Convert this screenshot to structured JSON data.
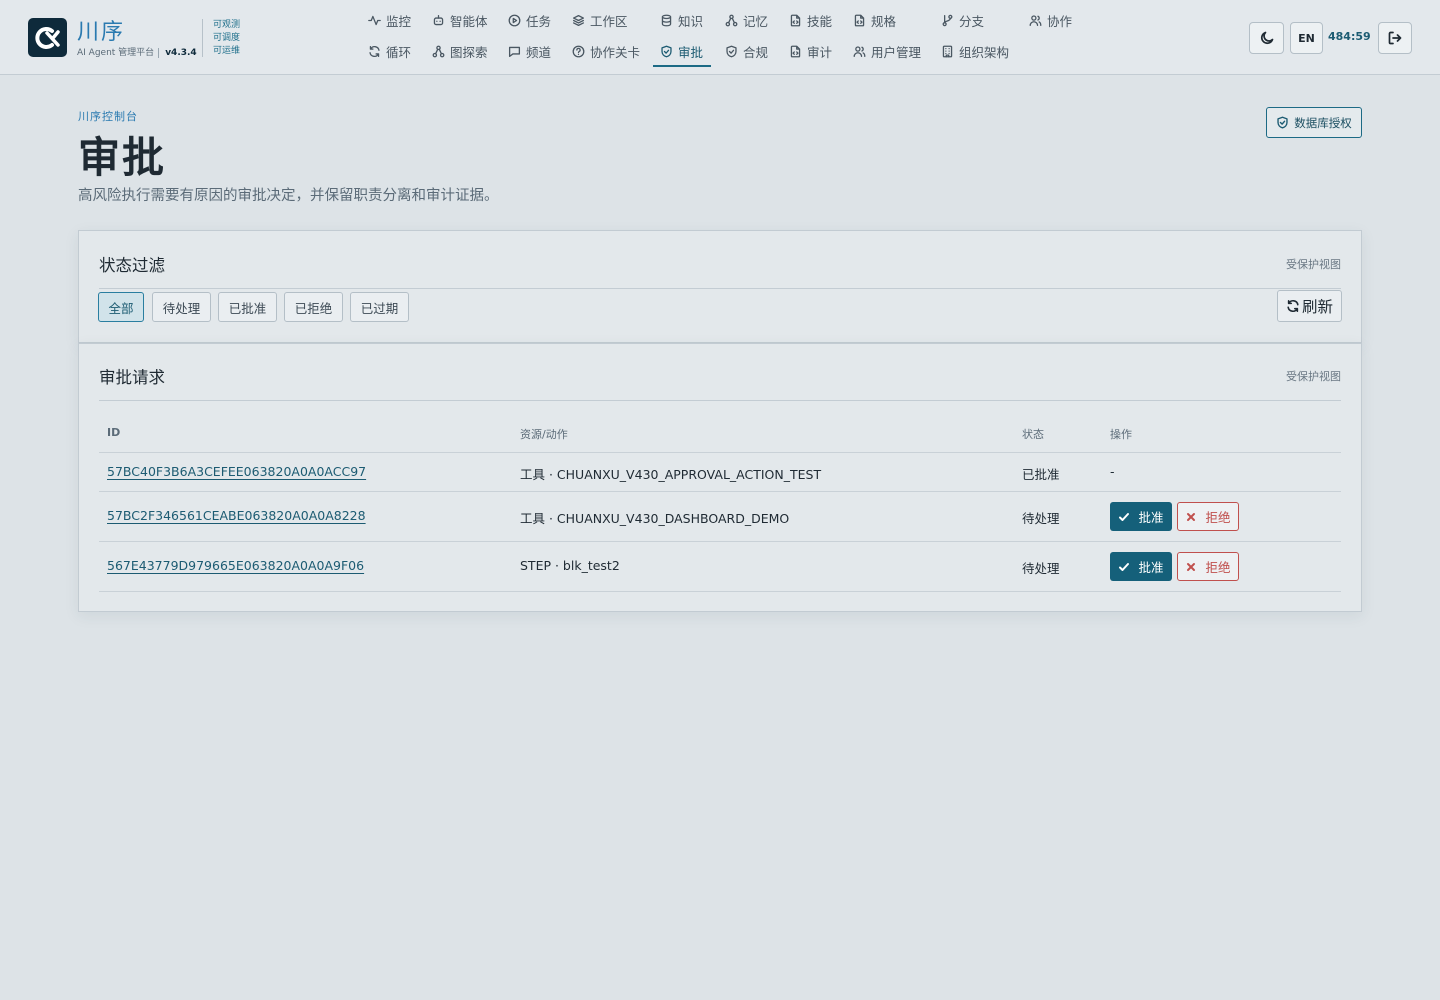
{
  "brand": {
    "name": "川序",
    "subtitle": "AI Agent 管理平台",
    "version": "v4.3.4",
    "tags": [
      "可观测",
      "可调度",
      "可运维"
    ]
  },
  "nav": {
    "row1": [
      "监控",
      "智能体",
      "任务",
      "工作区",
      "知识",
      "记忆",
      "技能",
      "规格",
      "分支",
      "协作"
    ],
    "row2": [
      "循环",
      "图探索",
      "频道",
      "协作关卡",
      "审批",
      "合规",
      "审计",
      "用户管理",
      "组织架构"
    ],
    "active": "审批"
  },
  "header_actions": {
    "lang": "EN",
    "timer": "484:59"
  },
  "page": {
    "breadcrumb": "川序控制台",
    "title": "审批",
    "description": "高风险执行需要有原因的审批决定，并保留职责分离和审计证据。",
    "db_button": "数据库授权"
  },
  "filter_panel": {
    "title": "状态过滤",
    "tag": "受保护视图",
    "filters": [
      "全部",
      "待处理",
      "已批准",
      "已拒绝",
      "已过期"
    ],
    "active_filter": "全部",
    "refresh": "刷新"
  },
  "requests_panel": {
    "title": "审批请求",
    "tag": "受保护视图",
    "columns": [
      "ID",
      "资源/动作",
      "状态",
      "操作"
    ],
    "rows": [
      {
        "id": "57BC40F3B6A3CEFEE063820A0A0ACC97",
        "resource": "工具 · CHUANXU_V430_APPROVAL_ACTION_TEST",
        "status": "已批准",
        "action": "-"
      },
      {
        "id": "57BC2F346561CEABE063820A0A0A8228",
        "resource": "工具 · CHUANXU_V430_DASHBOARD_DEMO",
        "status": "待处理",
        "approve": "批准",
        "reject": "拒绝"
      },
      {
        "id": "567E43779D979665E063820A0A0A9F06",
        "resource": "STEP · blk_test2",
        "status": "待处理",
        "approve": "批准",
        "reject": "拒绝"
      }
    ]
  },
  "colors": {
    "accent": "#15607a",
    "link": "#1c5b72",
    "brand": "#2a7ab0",
    "reject": "#c0504d",
    "background": "#dde3e7"
  }
}
